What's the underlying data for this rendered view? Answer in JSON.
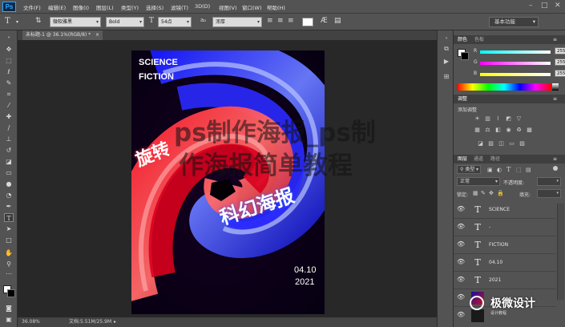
{
  "app": {
    "logo": "Ps"
  },
  "menu": [
    "文件(F)",
    "编辑(E)",
    "图像(I)",
    "图层(L)",
    "类型(Y)",
    "选择(S)",
    "滤镜(T)",
    "3D(D)",
    "视图(V)",
    "窗口(W)",
    "帮助(H)"
  ],
  "options": {
    "tool_icon": "T",
    "font_family": "微软雅黑",
    "font_style": "Bold",
    "font_size": "54点",
    "antialias_mode": "浑厚",
    "workspace": "基本功能"
  },
  "document": {
    "tab_label": "未标题-1 @ 36.1%(RGB/8) *",
    "zoom": "36.08%",
    "doc_size": "文档:5.51M/25.9M"
  },
  "poster": {
    "title_line1": "SCIENCE",
    "title_line2": "FICTION",
    "slogan_left": "旋转",
    "slogan_right": "科幻海报",
    "date": "04.10",
    "year": "2021"
  },
  "watermark": {
    "line1": "ps制作海报_ps制",
    "line2": "作海报简单教程"
  },
  "color_panel": {
    "tab_color": "颜色",
    "tab_swatches": "色板",
    "r_label": "R",
    "g_label": "G",
    "b_label": "B",
    "r_value": "255",
    "g_value": "255",
    "b_value": "255"
  },
  "adjustments": {
    "tab": "调整",
    "label": "添加调整"
  },
  "layers_panel": {
    "tabs": [
      "图层",
      "通道",
      "路径"
    ],
    "kind_filter": "类型",
    "blend_mode": "正常",
    "opacity_label": "不透明度:",
    "lock_label": "锁定:",
    "fill_label": "填充:",
    "layers": [
      {
        "name": "SCIENCE"
      },
      {
        "name": "-"
      },
      {
        "name": "FICTION"
      },
      {
        "name": "04.10"
      },
      {
        "name": "2021"
      }
    ]
  },
  "brand_watermark": {
    "text": "极微设计",
    "subtext": "设计教程"
  },
  "colors": {
    "ui_bg": "#535353",
    "panel_dark": "#3f3f3f",
    "accent": "#31a8ff"
  }
}
